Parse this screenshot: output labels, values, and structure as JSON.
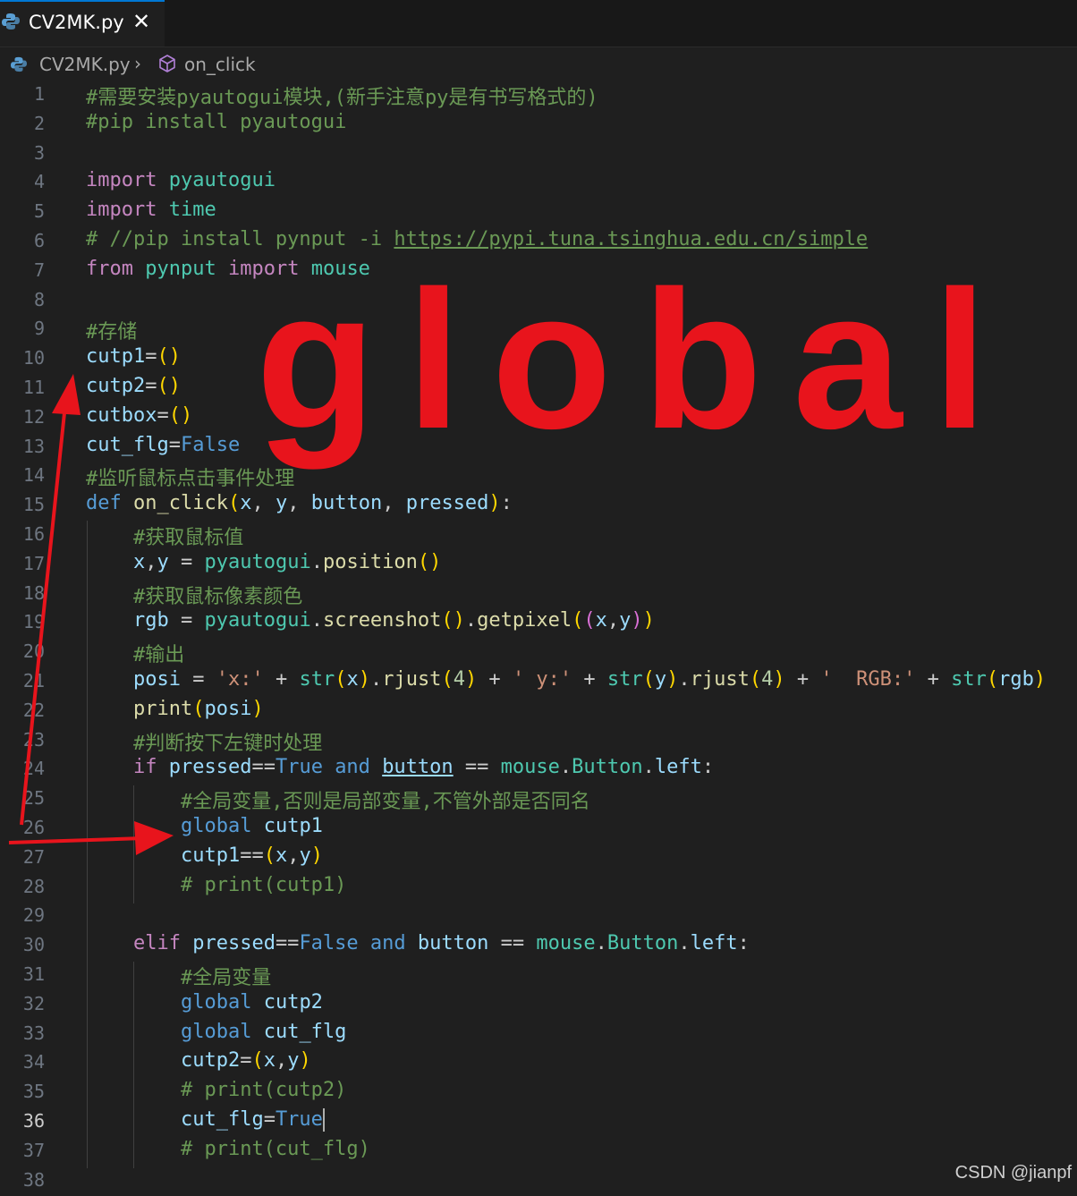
{
  "tab": {
    "file_name": "CV2MK.py",
    "close_glyph": "✕"
  },
  "breadcrumb": {
    "file": "CV2MK.py",
    "separator": "›",
    "symbol": "on_click"
  },
  "overlay_text": "global",
  "watermark": "CSDN @jianpf",
  "active_line": 36,
  "colors": {
    "annotation_red": "#e8141c",
    "tab_accent": "#0078d4"
  },
  "code_lines": [
    {
      "n": "1",
      "t": [
        [
          "#需要安装pyautogui模块,(新手注意py是有书写格式的)",
          "cm"
        ]
      ]
    },
    {
      "n": "2",
      "t": [
        [
          "#pip install pyautogui",
          "cm"
        ]
      ]
    },
    {
      "n": "3",
      "t": []
    },
    {
      "n": "4",
      "t": [
        [
          "import",
          "kw"
        ],
        [
          " ",
          ""
        ],
        [
          "pyautogui",
          "cls"
        ]
      ]
    },
    {
      "n": "5",
      "t": [
        [
          "import",
          "kw"
        ],
        [
          " ",
          ""
        ],
        [
          "time",
          "cls"
        ]
      ]
    },
    {
      "n": "6",
      "t": [
        [
          "# //pip install pynput -i ",
          "cm"
        ],
        [
          "https://pypi.tuna.tsinghua.edu.cn/simple",
          "cm link"
        ]
      ]
    },
    {
      "n": "7",
      "t": [
        [
          "from",
          "kw"
        ],
        [
          " ",
          ""
        ],
        [
          "pynput",
          "cls"
        ],
        [
          " ",
          ""
        ],
        [
          "import",
          "kw"
        ],
        [
          " ",
          ""
        ],
        [
          "mouse",
          "cls"
        ]
      ]
    },
    {
      "n": "8",
      "t": []
    },
    {
      "n": "9",
      "t": [
        [
          "#存储",
          "cm"
        ]
      ]
    },
    {
      "n": "10",
      "t": [
        [
          "cutp1",
          "var"
        ],
        [
          "=",
          ""
        ],
        [
          "()",
          "br1"
        ]
      ]
    },
    {
      "n": "11",
      "t": [
        [
          "cutp2",
          "var"
        ],
        [
          "=",
          ""
        ],
        [
          "()",
          "br1"
        ]
      ]
    },
    {
      "n": "12",
      "t": [
        [
          "cutbox",
          "var"
        ],
        [
          "=",
          ""
        ],
        [
          "()",
          "br1"
        ]
      ]
    },
    {
      "n": "13",
      "t": [
        [
          "cut_flg",
          "var"
        ],
        [
          "=",
          ""
        ],
        [
          "False",
          "kw2"
        ]
      ]
    },
    {
      "n": "14",
      "t": [
        [
          "#监听鼠标点击事件处理",
          "cm"
        ]
      ]
    },
    {
      "n": "15",
      "t": [
        [
          "def",
          "kw2"
        ],
        [
          " ",
          ""
        ],
        [
          "on_click",
          "fn"
        ],
        [
          "(",
          "br1"
        ],
        [
          "x",
          "var"
        ],
        [
          ", ",
          ""
        ],
        [
          "y",
          "var"
        ],
        [
          ", ",
          ""
        ],
        [
          "button",
          "var"
        ],
        [
          ", ",
          ""
        ],
        [
          "pressed",
          "var"
        ],
        [
          ")",
          "br1"
        ],
        [
          ":",
          ""
        ]
      ]
    },
    {
      "n": "16",
      "t": [
        [
          "    ",
          ""
        ],
        [
          "#获取鼠标值",
          "cm"
        ]
      ]
    },
    {
      "n": "17",
      "t": [
        [
          "    ",
          ""
        ],
        [
          "x",
          "var"
        ],
        [
          ",",
          ""
        ],
        [
          "y",
          "var"
        ],
        [
          " = ",
          ""
        ],
        [
          "pyautogui",
          "cls"
        ],
        [
          ".",
          ""
        ],
        [
          "position",
          "fn"
        ],
        [
          "()",
          "br1"
        ]
      ]
    },
    {
      "n": "18",
      "t": [
        [
          "    ",
          ""
        ],
        [
          "#获取鼠标像素颜色",
          "cm"
        ]
      ]
    },
    {
      "n": "19",
      "t": [
        [
          "    ",
          ""
        ],
        [
          "rgb",
          "var"
        ],
        [
          " = ",
          ""
        ],
        [
          "pyautogui",
          "cls"
        ],
        [
          ".",
          ""
        ],
        [
          "screenshot",
          "fn"
        ],
        [
          "()",
          "br1"
        ],
        [
          ".",
          ""
        ],
        [
          "getpixel",
          "fn"
        ],
        [
          "(",
          "br1"
        ],
        [
          "(",
          "br2"
        ],
        [
          "x",
          "var"
        ],
        [
          ",",
          ""
        ],
        [
          "y",
          "var"
        ],
        [
          ")",
          "br2"
        ],
        [
          ")",
          "br1"
        ]
      ]
    },
    {
      "n": "20",
      "t": [
        [
          "    ",
          ""
        ],
        [
          "#输出",
          "cm"
        ]
      ]
    },
    {
      "n": "21",
      "t": [
        [
          "    ",
          ""
        ],
        [
          "posi",
          "var"
        ],
        [
          " = ",
          ""
        ],
        [
          "'x:'",
          "str"
        ],
        [
          " + ",
          ""
        ],
        [
          "str",
          "cls"
        ],
        [
          "(",
          "br1"
        ],
        [
          "x",
          "var"
        ],
        [
          ")",
          "br1"
        ],
        [
          ".",
          ""
        ],
        [
          "rjust",
          "fn"
        ],
        [
          "(",
          "br1"
        ],
        [
          "4",
          "num"
        ],
        [
          ")",
          "br1"
        ],
        [
          " + ",
          ""
        ],
        [
          "' y:'",
          "str"
        ],
        [
          " + ",
          ""
        ],
        [
          "str",
          "cls"
        ],
        [
          "(",
          "br1"
        ],
        [
          "y",
          "var"
        ],
        [
          ")",
          "br1"
        ],
        [
          ".",
          ""
        ],
        [
          "rjust",
          "fn"
        ],
        [
          "(",
          "br1"
        ],
        [
          "4",
          "num"
        ],
        [
          ")",
          "br1"
        ],
        [
          " + ",
          ""
        ],
        [
          "'  RGB:'",
          "str"
        ],
        [
          " + ",
          ""
        ],
        [
          "str",
          "cls"
        ],
        [
          "(",
          "br1"
        ],
        [
          "rgb",
          "var"
        ],
        [
          ")",
          "br1"
        ]
      ]
    },
    {
      "n": "22",
      "t": [
        [
          "    ",
          ""
        ],
        [
          "print",
          "fn"
        ],
        [
          "(",
          "br1"
        ],
        [
          "posi",
          "var"
        ],
        [
          ")",
          "br1"
        ]
      ]
    },
    {
      "n": "23",
      "t": [
        [
          "    ",
          ""
        ],
        [
          "#判断按下左键时处理",
          "cm"
        ]
      ]
    },
    {
      "n": "24",
      "t": [
        [
          "    ",
          ""
        ],
        [
          "if",
          "kw"
        ],
        [
          " ",
          ""
        ],
        [
          "pressed",
          "var"
        ],
        [
          "==",
          ""
        ],
        [
          "True",
          "kw2"
        ],
        [
          " ",
          ""
        ],
        [
          "and",
          "kw2"
        ],
        [
          " ",
          ""
        ],
        [
          "button",
          "var uline"
        ],
        [
          " == ",
          ""
        ],
        [
          "mouse",
          "cls"
        ],
        [
          ".",
          ""
        ],
        [
          "Button",
          "cls"
        ],
        [
          ".",
          ""
        ],
        [
          "left",
          "var"
        ],
        [
          ":",
          ""
        ]
      ]
    },
    {
      "n": "25",
      "t": [
        [
          "        ",
          ""
        ],
        [
          "#全局变量,否则是局部变量,不管外部是否同名",
          "cm"
        ]
      ]
    },
    {
      "n": "26",
      "t": [
        [
          "        ",
          ""
        ],
        [
          "global",
          "kw2"
        ],
        [
          " ",
          ""
        ],
        [
          "cutp1",
          "var"
        ]
      ]
    },
    {
      "n": "27",
      "t": [
        [
          "        ",
          ""
        ],
        [
          "cutp1",
          "var"
        ],
        [
          "==",
          ""
        ],
        [
          "(",
          "br1"
        ],
        [
          "x",
          "var"
        ],
        [
          ",",
          ""
        ],
        [
          "y",
          "var"
        ],
        [
          ")",
          "br1"
        ]
      ]
    },
    {
      "n": "28",
      "t": [
        [
          "        ",
          ""
        ],
        [
          "# print(cutp1)",
          "cm"
        ]
      ]
    },
    {
      "n": "29",
      "t": []
    },
    {
      "n": "30",
      "t": [
        [
          "    ",
          ""
        ],
        [
          "elif",
          "kw"
        ],
        [
          " ",
          ""
        ],
        [
          "pressed",
          "var"
        ],
        [
          "==",
          ""
        ],
        [
          "False",
          "kw2"
        ],
        [
          " ",
          ""
        ],
        [
          "and",
          "kw2"
        ],
        [
          " ",
          ""
        ],
        [
          "button",
          "var"
        ],
        [
          " == ",
          ""
        ],
        [
          "mouse",
          "cls"
        ],
        [
          ".",
          ""
        ],
        [
          "Button",
          "cls"
        ],
        [
          ".",
          ""
        ],
        [
          "left",
          "var"
        ],
        [
          ":",
          ""
        ]
      ]
    },
    {
      "n": "31",
      "t": [
        [
          "        ",
          ""
        ],
        [
          "#全局变量",
          "cm"
        ]
      ]
    },
    {
      "n": "32",
      "t": [
        [
          "        ",
          ""
        ],
        [
          "global",
          "kw2"
        ],
        [
          " ",
          ""
        ],
        [
          "cutp2",
          "var"
        ]
      ]
    },
    {
      "n": "33",
      "t": [
        [
          "        ",
          ""
        ],
        [
          "global",
          "kw2"
        ],
        [
          " ",
          ""
        ],
        [
          "cut_flg",
          "var"
        ]
      ]
    },
    {
      "n": "34",
      "t": [
        [
          "        ",
          ""
        ],
        [
          "cutp2",
          "var"
        ],
        [
          "=",
          ""
        ],
        [
          "(",
          "br1"
        ],
        [
          "x",
          "var"
        ],
        [
          ",",
          ""
        ],
        [
          "y",
          "var"
        ],
        [
          ")",
          "br1"
        ]
      ]
    },
    {
      "n": "35",
      "t": [
        [
          "        ",
          ""
        ],
        [
          "# print(cutp2)",
          "cm"
        ]
      ]
    },
    {
      "n": "36",
      "t": [
        [
          "        ",
          ""
        ],
        [
          "cut_flg",
          "var"
        ],
        [
          "=",
          ""
        ],
        [
          "True",
          "kw2"
        ]
      ]
    },
    {
      "n": "37",
      "t": [
        [
          "        ",
          ""
        ],
        [
          "# print(cut_flg)",
          "cm"
        ]
      ]
    },
    {
      "n": "38",
      "t": []
    }
  ]
}
